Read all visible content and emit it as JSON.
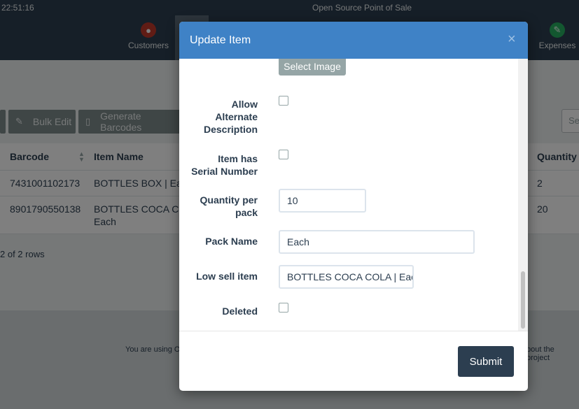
{
  "topbar": {
    "clock": "22:51:16",
    "app_name": "Open Source Point of Sale"
  },
  "nav": {
    "customers": "Customers",
    "expenses": "Expenses"
  },
  "toolbar": {
    "bulk_edit": "Bulk Edit",
    "generate_barcodes": "Generate Barcodes",
    "search_placeholder": "Se"
  },
  "table": {
    "headers": {
      "barcode": "Barcode",
      "item_name": "Item Name",
      "quantity": "Quantity"
    },
    "rows": [
      {
        "barcode": "7431001102173",
        "item_name": "BOTTLES BOX | Each",
        "quantity": "2"
      },
      {
        "barcode": "8901790550138",
        "item_name_line1": "BOTTLES COCA COL",
        "item_name_line2": "Each",
        "quantity": "20"
      }
    ],
    "rows_info": "2 of 2 rows"
  },
  "footer": {
    "left_text": "You are using O",
    "right_text": "bout the project"
  },
  "modal": {
    "title": "Update Item",
    "close": "×",
    "select_image": "Select Image",
    "fields": {
      "allow_alt_desc": [
        "Allow",
        "Alternate",
        "Description"
      ],
      "serial_number": [
        "Item has",
        "Serial Number"
      ],
      "qty_per_pack_label": [
        "Quantity per",
        "pack"
      ],
      "qty_per_pack_value": "10",
      "pack_name_label": "Pack Name",
      "pack_name_value": "Each",
      "low_sell_label": "Low sell item",
      "low_sell_value": "BOTTLES COCA COLA | Each",
      "deleted_label": "Deleted"
    },
    "submit": "Submit"
  }
}
